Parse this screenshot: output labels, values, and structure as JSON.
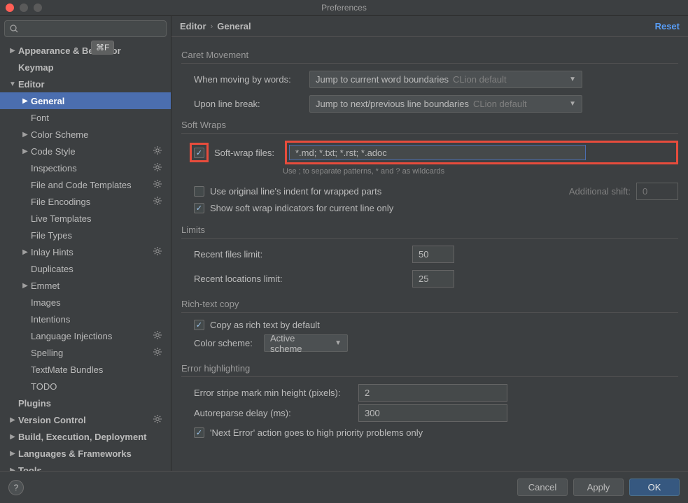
{
  "window": {
    "title": "Preferences"
  },
  "search": {
    "placeholder": "",
    "shortcut": "⌘F"
  },
  "breadcrumb": {
    "a": "Editor",
    "b": "General",
    "reset": "Reset"
  },
  "sidebar": {
    "items": [
      {
        "label": "Appearance & Behavior",
        "level": 0,
        "arrow": "▶",
        "bold": true
      },
      {
        "label": "Keymap",
        "level": 0,
        "arrow": "",
        "bold": true
      },
      {
        "label": "Editor",
        "level": 0,
        "arrow": "▼",
        "bold": true
      },
      {
        "label": "General",
        "level": 1,
        "arrow": "▶",
        "bold": true,
        "selected": true
      },
      {
        "label": "Font",
        "level": 1,
        "arrow": ""
      },
      {
        "label": "Color Scheme",
        "level": 1,
        "arrow": "▶"
      },
      {
        "label": "Code Style",
        "level": 1,
        "arrow": "▶",
        "gear": true
      },
      {
        "label": "Inspections",
        "level": 1,
        "arrow": "",
        "gear": true
      },
      {
        "label": "File and Code Templates",
        "level": 1,
        "arrow": "",
        "gear": true
      },
      {
        "label": "File Encodings",
        "level": 1,
        "arrow": "",
        "gear": true
      },
      {
        "label": "Live Templates",
        "level": 1,
        "arrow": ""
      },
      {
        "label": "File Types",
        "level": 1,
        "arrow": ""
      },
      {
        "label": "Inlay Hints",
        "level": 1,
        "arrow": "▶",
        "gear": true
      },
      {
        "label": "Duplicates",
        "level": 1,
        "arrow": ""
      },
      {
        "label": "Emmet",
        "level": 1,
        "arrow": "▶"
      },
      {
        "label": "Images",
        "level": 1,
        "arrow": ""
      },
      {
        "label": "Intentions",
        "level": 1,
        "arrow": ""
      },
      {
        "label": "Language Injections",
        "level": 1,
        "arrow": "",
        "gear": true
      },
      {
        "label": "Spelling",
        "level": 1,
        "arrow": "",
        "gear": true
      },
      {
        "label": "TextMate Bundles",
        "level": 1,
        "arrow": ""
      },
      {
        "label": "TODO",
        "level": 1,
        "arrow": ""
      },
      {
        "label": "Plugins",
        "level": 0,
        "arrow": "",
        "bold": true
      },
      {
        "label": "Version Control",
        "level": 0,
        "arrow": "▶",
        "bold": true,
        "gear": true
      },
      {
        "label": "Build, Execution, Deployment",
        "level": 0,
        "arrow": "▶",
        "bold": true
      },
      {
        "label": "Languages & Frameworks",
        "level": 0,
        "arrow": "▶",
        "bold": true
      },
      {
        "label": "Tools",
        "level": 0,
        "arrow": "▶",
        "bold": true
      }
    ]
  },
  "sections": {
    "caret": {
      "title": "Caret Movement",
      "whenMovingLabel": "When moving by words:",
      "whenMovingValue": "Jump to current word boundaries",
      "whenMovingHint": "CLion default",
      "uponBreakLabel": "Upon line break:",
      "uponBreakValue": "Jump to next/previous line boundaries",
      "uponBreakHint": "CLion default"
    },
    "softwraps": {
      "title": "Soft Wraps",
      "softWrapFilesLabel": "Soft-wrap files:",
      "softWrapFilesValue": "*.md; *.txt; *.rst; *.adoc",
      "hint": "Use ; to separate patterns, * and ? as wildcards",
      "useOriginalLabel": "Use original line's indent for wrapped parts",
      "additionalShiftLabel": "Additional shift:",
      "additionalShiftValue": "0",
      "showIndicatorsLabel": "Show soft wrap indicators for current line only"
    },
    "limits": {
      "title": "Limits",
      "recentFilesLabel": "Recent files limit:",
      "recentFilesValue": "50",
      "recentLocationsLabel": "Recent locations limit:",
      "recentLocationsValue": "25"
    },
    "richtext": {
      "title": "Rich-text copy",
      "copyRichLabel": "Copy as rich text by default",
      "colorSchemeLabel": "Color scheme:",
      "colorSchemeValue": "Active scheme"
    },
    "errorhl": {
      "title": "Error highlighting",
      "stripeLabel": "Error stripe mark min height (pixels):",
      "stripeValue": "2",
      "autoreparseLabel": "Autoreparse delay (ms):",
      "autoreparseValue": "300",
      "nextErrorLabel": "'Next Error' action goes to high priority problems only"
    }
  },
  "footer": {
    "cancel": "Cancel",
    "apply": "Apply",
    "ok": "OK",
    "help": "?"
  }
}
